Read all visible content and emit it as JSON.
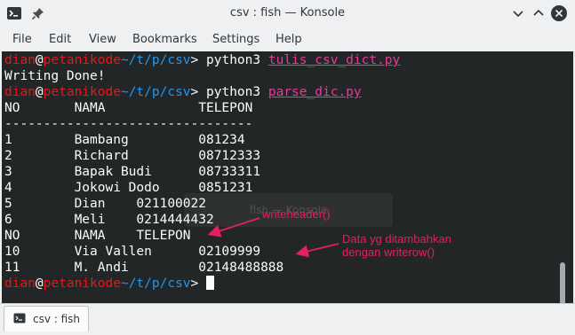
{
  "window": {
    "title": "csv : fish — Konsole"
  },
  "menubar": {
    "items": [
      "File",
      "Edit",
      "View",
      "Bookmarks",
      "Settings",
      "Help"
    ]
  },
  "terminal": {
    "prompt": {
      "user": "dian",
      "at": "@",
      "host": "petanikode",
      "path": "~/t/p/csv",
      "symbol": "> "
    },
    "cmd1": {
      "program": "python3",
      "file": "tulis_csv_dict.py"
    },
    "output1": "Writing Done!",
    "cmd2": {
      "program": "python3",
      "file": "parse_dic.py"
    },
    "header": "NO       NAMA            TELEPON",
    "separator": "--------------------------------",
    "rows": [
      "1        Bambang         081234",
      "2        Richard         08712333",
      "3        Bapak Budi      08733311",
      "4        Jokowi Dodo     0851231",
      "5        Dian    021100022",
      "6        Meli    0214444432",
      "NO       NAMA    TELEPON",
      "10       Via Vallen      02109999",
      "11       M. Andi         02148488888"
    ],
    "ghost_text": "Konsole",
    "ghost_prefix": "fish"
  },
  "annotations": {
    "writeheader": "writeheader()",
    "writerow_line1": "Data yg ditambahkan",
    "writerow_line2": "dengan writerow()",
    "color": "#e61e62"
  },
  "tabbar": {
    "tab_label": "csv : fish"
  }
}
